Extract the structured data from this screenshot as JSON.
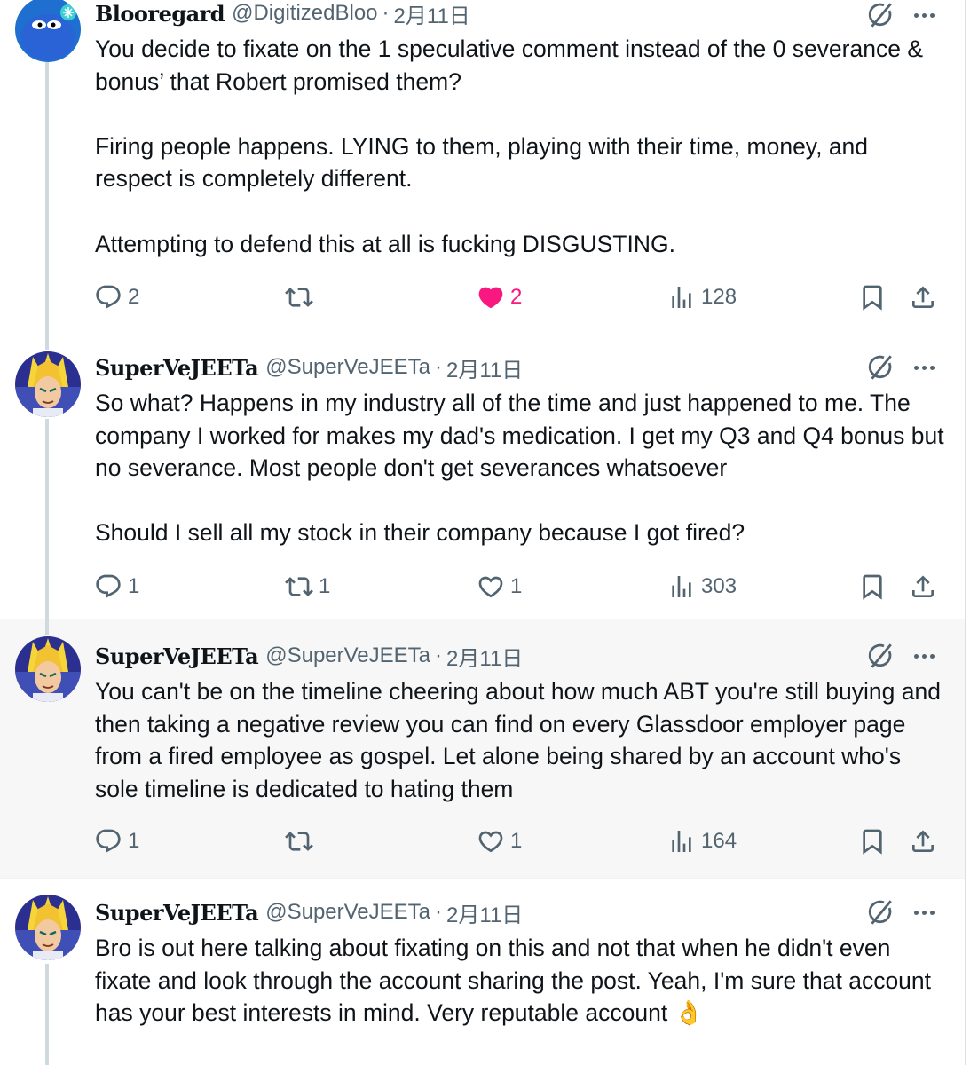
{
  "colors": {
    "text": "#0f1419",
    "secondary": "#536471",
    "like": "#f91880",
    "thread_line": "#cfd9de"
  },
  "tweets": [
    {
      "display_name": "Blooregard",
      "handle": "@DigitizedBloo",
      "date": "2月11日",
      "avatar_icon": "blue-cartoon-avatar",
      "text": "You decide to fixate on the 1 speculative comment instead of the 0 severance & bonus’ that Robert promised them?\n\nFiring people happens. LYING to them, playing with their time, money, and respect is completely different.\n\nAttempting to defend this at all is fucking DISGUSTING.",
      "replies": "2",
      "reposts": "",
      "likes": "2",
      "views": "128",
      "liked": true
    },
    {
      "display_name": "SuperVeJEETa",
      "handle": "@SuperVeJEETa",
      "date": "2月11日",
      "avatar_icon": "anime-vegeta-avatar",
      "text": "So what? Happens in my industry all of the time and just happened to me. The company I worked for makes my dad's medication. I get my Q3 and Q4 bonus but no severance. Most people don't get severances whatsoever\n\nShould I sell all my stock in their company because I got fired?",
      "replies": "1",
      "reposts": "1",
      "likes": "1",
      "views": "303",
      "liked": false
    },
    {
      "display_name": "SuperVeJEETa",
      "handle": "@SuperVeJEETa",
      "date": "2月11日",
      "avatar_icon": "anime-vegeta-avatar",
      "text": "You can't be on the timeline cheering about how much ABT you're still buying and then taking a negative review you can find on every Glassdoor employer page from a fired employee as gospel. Let alone being shared by an account who's sole timeline is dedicated to hating them",
      "replies": "1",
      "reposts": "",
      "likes": "1",
      "views": "164",
      "liked": false
    },
    {
      "display_name": "SuperVeJEETa",
      "handle": "@SuperVeJEETa",
      "date": "2月11日",
      "avatar_icon": "anime-vegeta-avatar",
      "text": "Bro is out here talking about fixating on this and not that when he didn't even fixate and look through the account sharing the post. Yeah, I'm sure that account has your best interests in mind. Very reputable account 👌",
      "replies": "",
      "reposts": "",
      "likes": "",
      "views": "",
      "liked": false
    }
  ]
}
